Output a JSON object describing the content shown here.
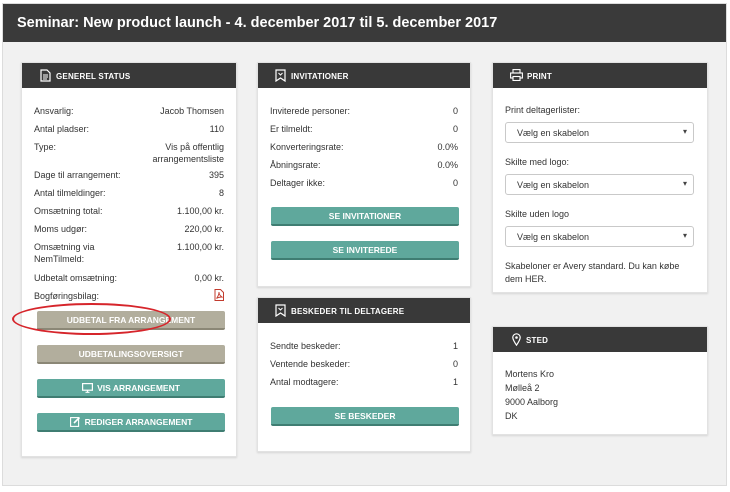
{
  "page": {
    "title": "Seminar: New product launch - 4. december 2017 til 5. december 2017"
  },
  "status": {
    "heading": "GENEREL STATUS",
    "rows": [
      {
        "label": "Ansvarlig:",
        "value": "Jacob Thomsen"
      },
      {
        "label": "Antal pladser:",
        "value": "110"
      },
      {
        "label": "Type:",
        "value": "Vis på offentlig arrangementsliste"
      },
      {
        "label": "Dage til arrangement:",
        "value": "395"
      },
      {
        "label": "Antal tilmeldinger:",
        "value": "8"
      },
      {
        "label": "Omsætning total:",
        "value": "1.100,00 kr."
      },
      {
        "label": "Moms udgør:",
        "value": "220,00 kr."
      },
      {
        "label": "Omsætning via NemTilmeld:",
        "value": "1.100,00 kr."
      },
      {
        "label": "Udbetalt omsætning:",
        "value": "0,00 kr."
      },
      {
        "label": "Bogføringsbilag:",
        "value": ""
      }
    ],
    "buttons": {
      "payout": "UDBETAL FRA ARRANGEMENT",
      "payout_overview": "UDBETALINGSOVERSIGT",
      "show_event": "VIS ARRANGEMENT",
      "edit_event": "REDIGER ARRANGEMENT"
    }
  },
  "invitations": {
    "heading": "INVITATIONER",
    "rows": [
      {
        "label": "Inviterede personer:",
        "value": "0"
      },
      {
        "label": "Er tilmeldt:",
        "value": "0"
      },
      {
        "label": "Konverteringsrate:",
        "value": "0.0%"
      },
      {
        "label": "Åbningsrate:",
        "value": "0.0%"
      },
      {
        "label": "Deltager ikke:",
        "value": "0"
      }
    ],
    "buttons": {
      "see_invitations": "SE INVITATIONER",
      "see_invited": "SE INVITEREDE"
    }
  },
  "messages": {
    "heading": "BESKEDER TIL DELTAGERE",
    "rows": [
      {
        "label": "Sendte beskeder:",
        "value": "1"
      },
      {
        "label": "Ventende beskeder:",
        "value": "0"
      },
      {
        "label": "Antal modtagere:",
        "value": "1"
      }
    ],
    "buttons": {
      "see_messages": "SE BESKEDER"
    }
  },
  "print": {
    "heading": "PRINT",
    "fields": [
      {
        "label": "Print deltagerlister:",
        "selected": "Vælg en skabelon"
      },
      {
        "label": "Skilte med logo:",
        "selected": "Vælg en skabelon"
      },
      {
        "label": "Skilte uden logo",
        "selected": "Vælg en skabelon"
      }
    ],
    "note": "Skabeloner er Avery standard. Du kan købe dem HER."
  },
  "place": {
    "heading": "STED",
    "lines": [
      "Mortens Kro",
      "Mølleå 2",
      "9000 Aalborg",
      "DK"
    ]
  },
  "colors": {
    "header": "#393939",
    "teal": "#5fa89c",
    "khaki": "#b2ae9d",
    "highlight": "#d6252b"
  }
}
